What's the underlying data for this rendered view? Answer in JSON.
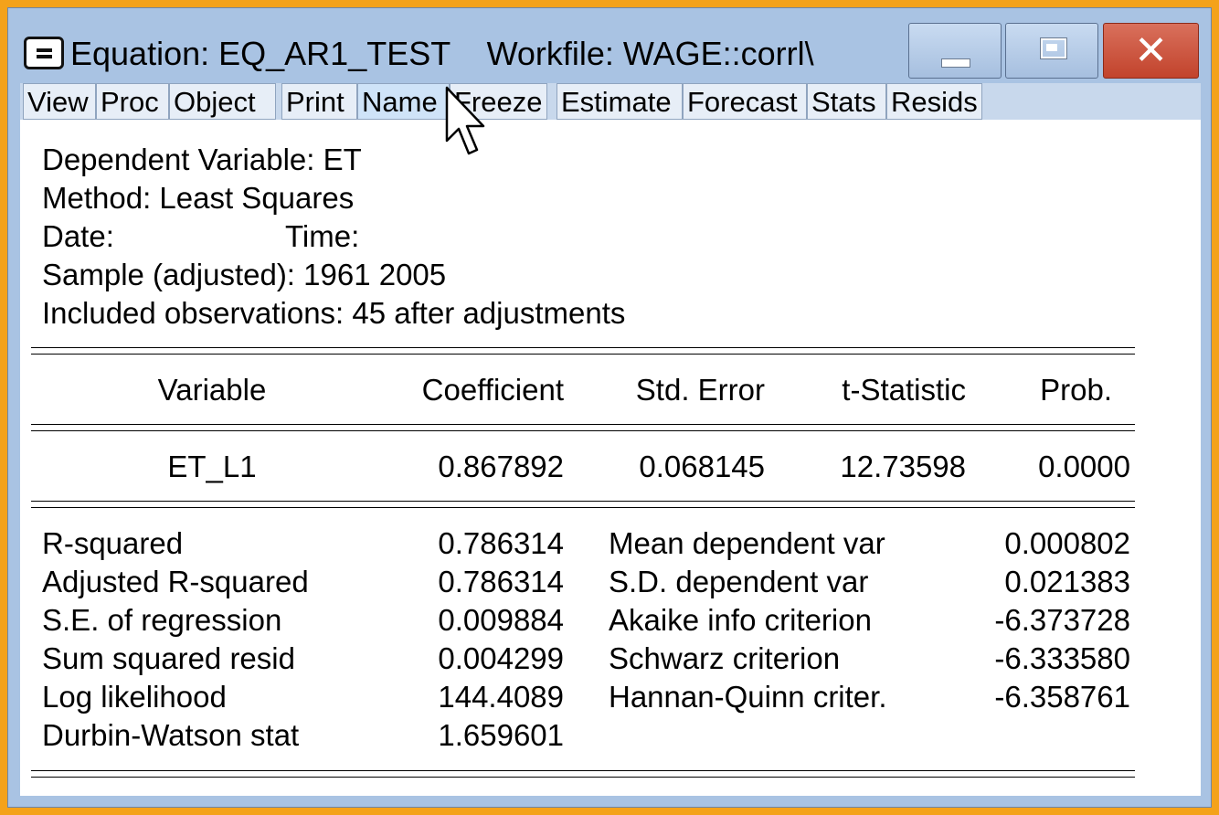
{
  "window": {
    "title": "Equation: EQ_AR1_TEST    Workfile: WAGE::corrl\\",
    "controls": {
      "minimize": "minimize",
      "maximize": "maximize",
      "close": "close"
    }
  },
  "menu": [
    "View",
    "Proc",
    "Object",
    "Print",
    "Name",
    "Freeze",
    "Estimate",
    "Forecast",
    "Stats",
    "Resids"
  ],
  "header": {
    "dependent": "Dependent Variable: ET",
    "method": "Method: Least Squares",
    "date_label": "Date:",
    "time_label": "Time:",
    "sample": "Sample (adjusted): 1961 2005",
    "observations": "Included observations: 45 after adjustments"
  },
  "table": {
    "columns": [
      "Variable",
      "Coefficient",
      "Std. Error",
      "t-Statistic",
      "Prob."
    ],
    "rows": [
      [
        "ET_L1",
        "0.867892",
        "0.068145",
        "12.73598",
        "0.0000"
      ]
    ]
  },
  "stats_left": [
    [
      "R-squared",
      "0.786314"
    ],
    [
      "Adjusted R-squared",
      "0.786314"
    ],
    [
      "S.E. of regression",
      "0.009884"
    ],
    [
      "Sum squared resid",
      "0.004299"
    ],
    [
      "Log likelihood",
      "144.4089"
    ],
    [
      "Durbin-Watson stat",
      "1.659601"
    ]
  ],
  "stats_right": [
    [
      "Mean dependent var",
      "0.000802"
    ],
    [
      "S.D. dependent var",
      "0.021383"
    ],
    [
      "Akaike info criterion",
      "-6.373728"
    ],
    [
      "Schwarz criterion",
      "-6.333580"
    ],
    [
      "Hannan-Quinn criter.",
      "-6.358761"
    ]
  ]
}
